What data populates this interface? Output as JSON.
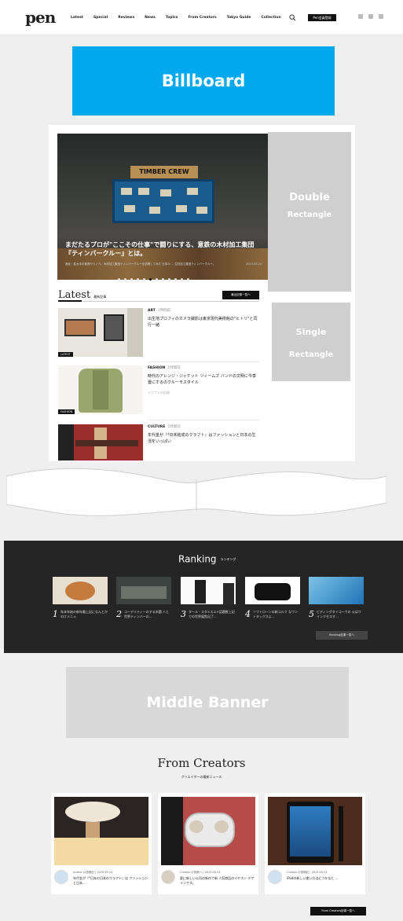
{
  "header": {
    "logo": "pen",
    "nav": [
      "Latest",
      "Special",
      "Reviews",
      "News",
      "Topics",
      "From Creators",
      "Tokyo Guide",
      "Collection"
    ],
    "members_button": "Pen会員登録"
  },
  "ads": {
    "billboard": "Billboard",
    "double_rect_line1": "Double",
    "double_rect_line2": "Rectangle",
    "single_rect_line1": "Single",
    "single_rect_line2": "Rectangle",
    "middle_banner": "Middle Banner"
  },
  "hero": {
    "sign": "TIMBER CREW",
    "caption_line1": "まだたるプロが\"ここその仕事\"で闘りにする、意鉄の木材加工集団",
    "caption_line2": "『ティンバークルー』とは。",
    "meta": "進化・拡大中の家具やリノベ、木材加工集団ティンバークルーを訪問してみた 日本の ... 生材加工集団ティンバークルー。",
    "date": "2023.05.24"
  },
  "latest": {
    "title": "Latest",
    "subtitle": "最新記事",
    "see_all": "最近記事一覧へ",
    "articles": [
      {
        "tag": "LATEST",
        "category": "ART",
        "time": "1時間前",
        "title": "出生地プロフィのカメラ撮影は東京現代美術館の\"ヒトリ\"と同行一緒",
        "sub": ""
      },
      {
        "tag": "FASHION",
        "category": "FASHION",
        "time": "1時間前",
        "title": "時代のアレンジ・ジャケット ツィームズ パンドの文明に今季置にするのクルーモスタイル",
        "sub": "ミニファの記録"
      },
      {
        "tag": "",
        "category": "CULTURE",
        "time": "1時間前",
        "title": "年代金が『*日未結成のクラフト』はファッションと日本の生活をいっぱい",
        "sub": ""
      }
    ]
  },
  "ranking": {
    "title": "Ranking",
    "subtitle": "ランキング",
    "see_all": "Ranking記事一覧へ",
    "items": [
      {
        "num": "1",
        "text": "年末年始の新年最上記になんとかのけメニュ"
      },
      {
        "num": "2",
        "text": "コーデリティーのする本題 人と世界ティンバーの..."
      },
      {
        "num": "3",
        "text": "タール・スタ×スエ×話題数上記での世界展覧出了..."
      },
      {
        "num": "4",
        "text": "ソフトローンの新コルク なワントタックスよ..."
      },
      {
        "num": "5",
        "text": "ビディングタイコーでの 公はワインクセスす..."
      }
    ]
  },
  "creators": {
    "title": "From Creators",
    "subtitle": "クリエイターの最新ニュース",
    "see_all": "From Creators記事一覧へ",
    "cards": [
      {
        "author": "Author の投稿記",
        "date": "2023.05.24",
        "title": "年代金が『*日本の日本のクラフト』は ファッションと日本..."
      },
      {
        "author": "Creator の投稿へ",
        "date": "2023.05.24",
        "title": "夏に新しい公司の新作で新 人気商品のイヤホン デザインです。"
      },
      {
        "author": "Creator の投稿記",
        "date": "2023.05.24",
        "title": "iPadの新しい使い方はどうかなと ..."
      }
    ]
  },
  "colors": {
    "billboard": "#03a9ee",
    "ranking_bg": "#252525",
    "ad_gray": "#cfcfcf"
  }
}
